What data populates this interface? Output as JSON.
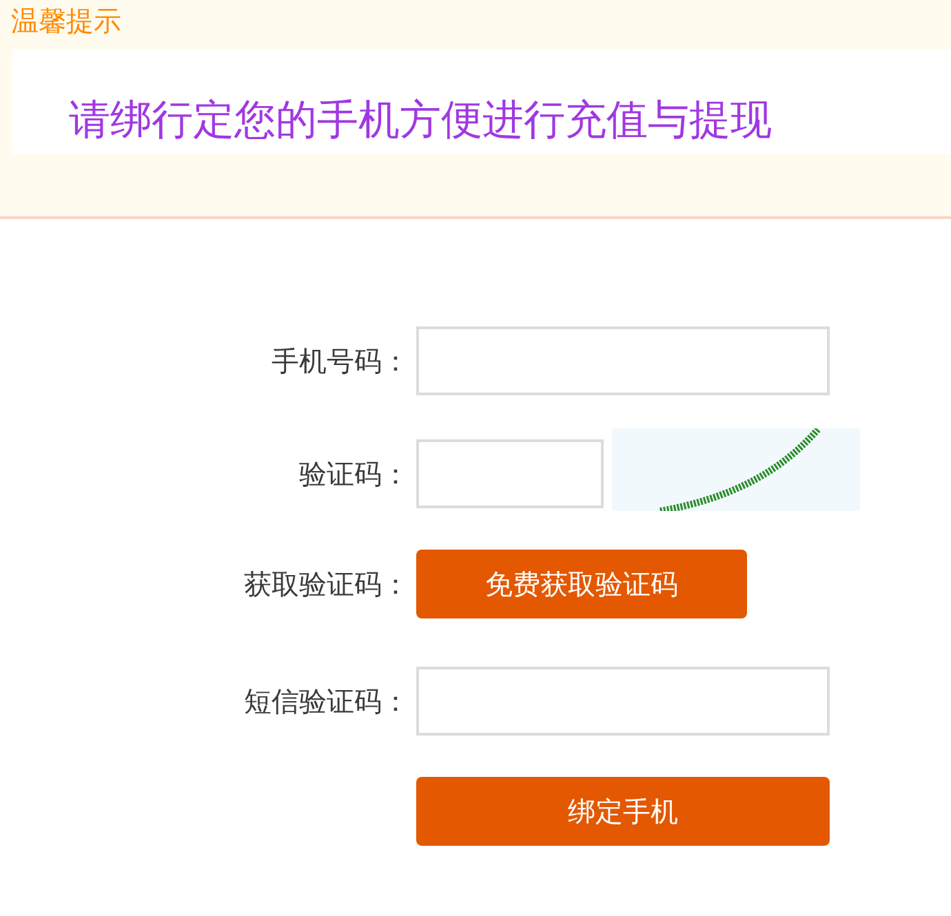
{
  "notice": {
    "title": "温馨提示",
    "message": "请绑行定您的手机方便进行充值与提现"
  },
  "form": {
    "rows": [
      {
        "kind": "input",
        "label": "手机号码："
      },
      {
        "kind": "captcha",
        "label": "验证码："
      },
      {
        "kind": "button",
        "label": "获取验证码：",
        "button": "免费获取验证码"
      },
      {
        "kind": "input",
        "label": "短信验证码："
      }
    ],
    "submit": "绑定手机"
  }
}
